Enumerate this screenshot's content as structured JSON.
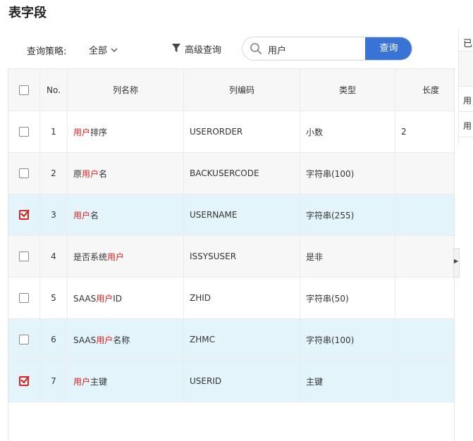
{
  "page": {
    "title": "表字段"
  },
  "toolbar": {
    "strategy_label": "查询策略:",
    "strategy_value": "全部",
    "advanced_label": "高级查询",
    "search_value": "用户",
    "search_button": "查询"
  },
  "table": {
    "headers": {
      "no": "No.",
      "name": "列名称",
      "code": "列编码",
      "type": "类型",
      "length": "长度"
    },
    "rows": [
      {
        "no": "1",
        "name_before": "",
        "name_hl": "用户",
        "name_after": "排序",
        "code": "USERORDER",
        "type": "小数",
        "length": "2",
        "checked": false
      },
      {
        "no": "2",
        "name_before": "原",
        "name_hl": "用户",
        "name_after": "名",
        "code": "BACKUSERCODE",
        "type": "字符串(100)",
        "length": "",
        "checked": false
      },
      {
        "no": "3",
        "name_before": "",
        "name_hl": "用户",
        "name_after": "名",
        "code": "USERNAME",
        "type": "字符串(255)",
        "length": "",
        "checked": true
      },
      {
        "no": "4",
        "name_before": "是否系统",
        "name_hl": "用户",
        "name_after": "",
        "code": "ISSYSUSER",
        "type": "是非",
        "length": "",
        "checked": false
      },
      {
        "no": "5",
        "name_before": "SAAS",
        "name_hl": "用户",
        "name_after": "ID",
        "code": "ZHID",
        "type": "字符串(50)",
        "length": "",
        "checked": false
      },
      {
        "no": "6",
        "name_before": "SAAS",
        "name_hl": "用户",
        "name_after": "名称",
        "code": "ZHMC",
        "type": "字符串(100)",
        "length": "",
        "checked": true
      },
      {
        "no": "7",
        "name_before": "",
        "name_hl": "用户",
        "name_after": "主键",
        "code": "USERID",
        "type": "主键",
        "length": "",
        "checked": true
      }
    ]
  },
  "right_panel": {
    "header": "已",
    "rows": [
      "用",
      "用"
    ]
  },
  "colors": {
    "accent": "#3a73d6",
    "highlight": "#e02020",
    "selected_row": "#e3f4fb"
  }
}
